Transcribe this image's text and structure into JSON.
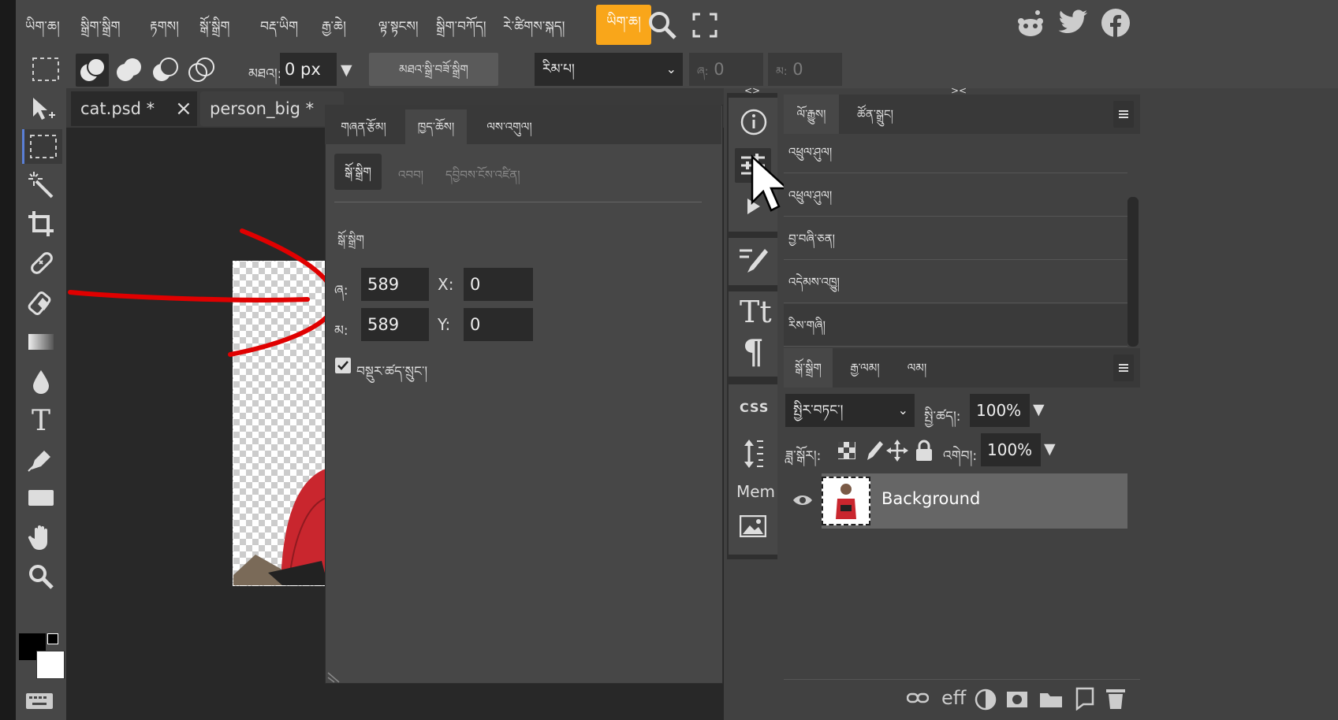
{
  "menu": {
    "items": [
      "ཡིག་ཆ།",
      "སྒྲིག་སྒྲིག",
      "རྟགས།",
      "སྒོ་སྒྲིག",
      "བརྡ་ཡིག",
      "རྒྱ་ཆེ།",
      "ལྟ་སྟངས།",
      "སྒྲིག་བཀོད།",
      "རེ་ཚིགས་སྐད།"
    ],
    "active": "ཡིག་ཆ།"
  },
  "social": [
    "reddit-icon",
    "twitter-icon",
    "facebook-icon"
  ],
  "options": {
    "feather_label": "མཐའ།:",
    "feather_value": "0 px",
    "refine_button": "མཐའ་སྒྲི་བཟོ་སྒྲིག",
    "style_select": "རིམ་པ།",
    "w_label": "ཞ:",
    "w_value": "0",
    "h_label": "མ:",
    "h_value": "0"
  },
  "doc_tabs": [
    {
      "name": "cat.psd *",
      "close": "×"
    },
    {
      "name": "person_big *",
      "close": "×"
    }
  ],
  "dialog": {
    "tabs": [
      "གཞན་རྩོམ།",
      "ཁྱད་ཆོས།",
      "ལས་འགུལ།"
    ],
    "active_tab": "ཁྱད་ཆོས།",
    "subtabs": [
      "སྒོ་སྒྲིག",
      "འབབ།",
      "དབྱིབས་ངོས་འཛིན།"
    ],
    "section_title": "སྒོ་སྒྲིག",
    "w_label": "ཞ:",
    "w_value": "589",
    "h_label": "མ:",
    "h_value": "589",
    "x_label": "X:",
    "x_value": "0",
    "y_label": "Y:",
    "y_value": "0",
    "constrain_label": "བསྡུར་ཚད་སྲུང་།"
  },
  "iconcol": {
    "collapse_left": "<>",
    "css_label": "CSS",
    "mem_label": "Mem"
  },
  "history": {
    "tabs": [
      "ལོ་རྒྱུས།",
      "ཚོན་སྒྲུང།"
    ],
    "collapse": "><",
    "rows": [
      "འཕྲུལ་ཤུལ།",
      "འཕྲུལ་ཤུལ།",
      "བྱ་བཞི་ཅན།",
      "འདེམས་འཁྱུ།",
      "རིས་གཞི།"
    ]
  },
  "layers": {
    "tabs": [
      "སྒོ་སྒྲིག",
      "རྒྱ་ལམ།",
      "ལམ།"
    ],
    "blend_mode": "སྤྱིར་བཏང་།",
    "opacity_label": "སྤྱི་ཚད།:",
    "opacity_value": "100%",
    "lock_label": "ཟླ་སྒོར།:",
    "fill_label": "འགེབ།:",
    "fill_value": "100%",
    "layer_name": "Background",
    "footer_fx": "eff"
  },
  "colors": {
    "accent": "#f9a61a",
    "stroke": "#e00000"
  }
}
